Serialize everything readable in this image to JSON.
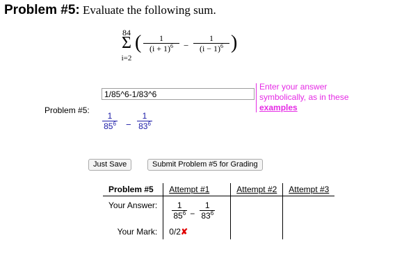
{
  "problem": {
    "title_bold": "Problem #5:",
    "title_rest": " Evaluate the following sum.",
    "sum_upper": "84",
    "sum_sigma": "Σ",
    "sum_lower": "i=2",
    "term1_num": "1",
    "term1_den": "(i + 1)",
    "term1_exp": "6",
    "term2_num": "1",
    "term2_den": "(i − 1)",
    "term2_exp": "6",
    "minus": "−"
  },
  "answer": {
    "input_value": "1/85^6-1/83^6",
    "hint_line1": "Enter your answer",
    "hint_line2": "symbolically, as in these",
    "hint_link": "examples",
    "label": "Problem #5:",
    "prev_num1": "1",
    "prev_den1": "85",
    "prev_exp1": "6",
    "prev_minus": "−",
    "prev_num2": "1",
    "prev_den2": "83",
    "prev_exp2": "6"
  },
  "buttons": {
    "save": "Just Save",
    "submit": "Submit Problem #5 for Grading"
  },
  "results": {
    "header": "Problem #5",
    "attempts": [
      "Attempt #1",
      "Attempt #2",
      "Attempt #3"
    ],
    "your_answer_label": "Your Answer:",
    "your_mark_label": "Your Mark:",
    "mark": "0/2",
    "mark_x": "✘",
    "ans_num1": "1",
    "ans_den1": "85",
    "ans_exp1": "6",
    "ans_minus": "−",
    "ans_num2": "1",
    "ans_den2": "83",
    "ans_exp2": "6"
  },
  "colors": {
    "hint": "#e52be5",
    "mark_x": "#e00000",
    "preview": "#1a1aa6"
  }
}
